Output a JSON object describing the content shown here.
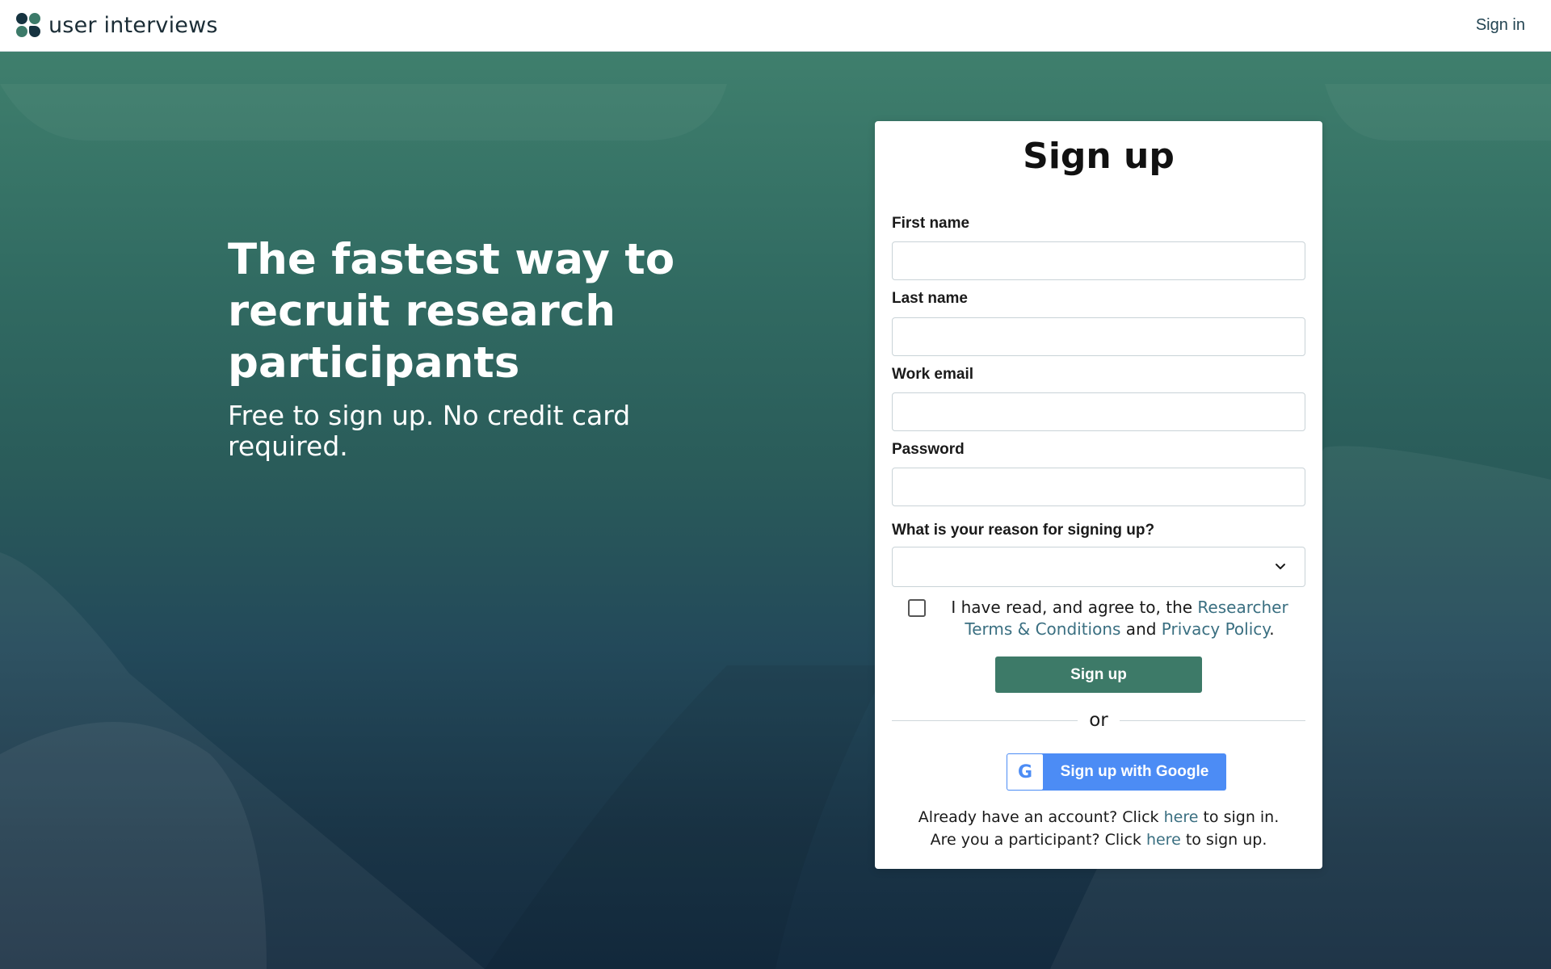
{
  "header": {
    "brand": "user interviews",
    "signin_label": "Sign in"
  },
  "hero": {
    "title": "The fastest way to recruit research participants",
    "subtitle": "Free to sign up. No credit card required."
  },
  "form": {
    "title": "Sign up",
    "fields": {
      "first_name": {
        "label": "First name",
        "value": "",
        "placeholder": ""
      },
      "last_name": {
        "label": "Last name",
        "value": "",
        "placeholder": ""
      },
      "work_email": {
        "label": "Work email",
        "value": "",
        "placeholder": ""
      },
      "password": {
        "label": "Password",
        "value": "",
        "placeholder": ""
      },
      "reason": {
        "label": "What is your reason for signing up?",
        "selected": ""
      }
    },
    "agree": {
      "prefix": "I have read, and agree to, the ",
      "terms_link": "Researcher Terms & Conditions",
      "middle": " and ",
      "privacy_link": "Privacy Policy",
      "suffix": "."
    },
    "submit_label": "Sign up",
    "divider_text": "or",
    "google": {
      "icon_letter": "G",
      "label": "Sign up with Google"
    },
    "footer": {
      "line1_prefix": "Already have an account? Click ",
      "line1_link": "here",
      "line1_suffix": " to sign in.",
      "line2_prefix": "Are you a participant? Click ",
      "line2_link": "here",
      "line2_suffix": " to sign up."
    }
  },
  "colors": {
    "brand_green": "#3d7a68",
    "google_blue": "#4c8cf5",
    "link": "#3a6f81",
    "bg_top": "#3f7f6d",
    "bg_bottom": "#142b3f"
  },
  "icons": {
    "logo": "user-interviews-logo-icon",
    "select": "chevron-down-icon",
    "google": "google-icon"
  }
}
